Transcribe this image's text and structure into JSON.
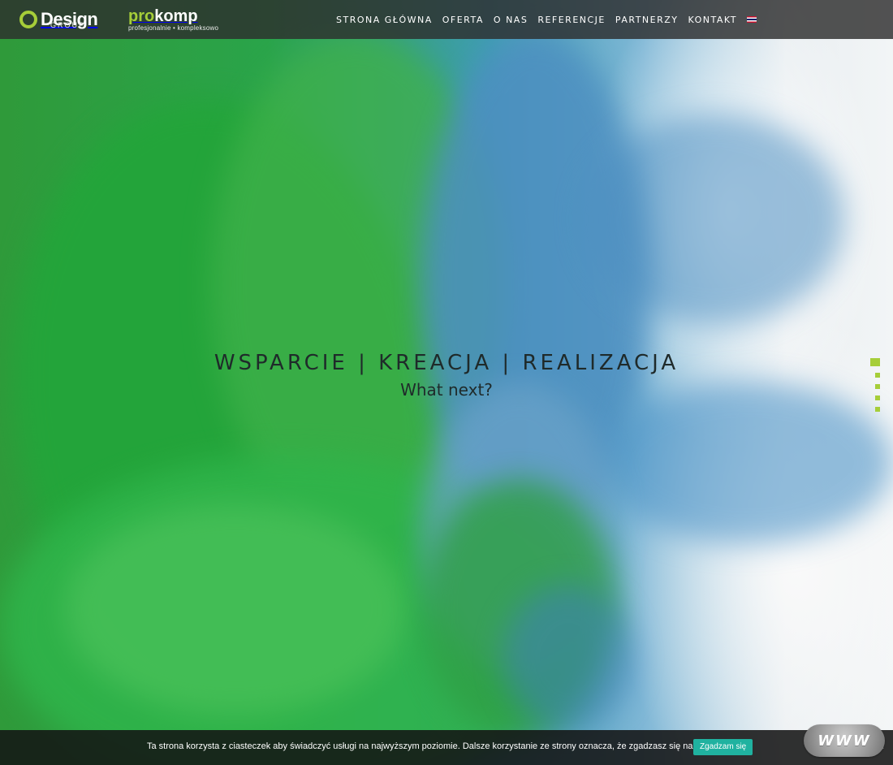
{
  "header": {
    "logo1": {
      "main": "Design",
      "sub": "GROUP"
    },
    "logo2": {
      "part1": "pro",
      "part2": "komp",
      "tagline": "profesjonalnie • kompleksowo"
    },
    "nav": [
      "STRONA GŁÓWNA",
      "OFERTA",
      "O NAS",
      "REFERENCJE",
      "PARTNERZY",
      "KONTAKT"
    ],
    "language_flag_icon": "uk-flag-icon"
  },
  "hero": {
    "title": "WSPARCIE | KREACJA | REALIZACJA",
    "subtitle": "What next?",
    "pager": {
      "count": 5,
      "active_index": 0,
      "color": "#a6ce39"
    }
  },
  "cookie_bar": {
    "text": "Ta strona korzysta z ciasteczek aby świadczyć usługi na najwyższym poziomie. Dalsze korzystanie ze strony oznacza, że zgadzasz się na ich użycie.",
    "accept": "Zgadzam się",
    "close_icon": "close-icon",
    "accent_color": "#20b2a0"
  },
  "badge": {
    "text": "WWW"
  }
}
